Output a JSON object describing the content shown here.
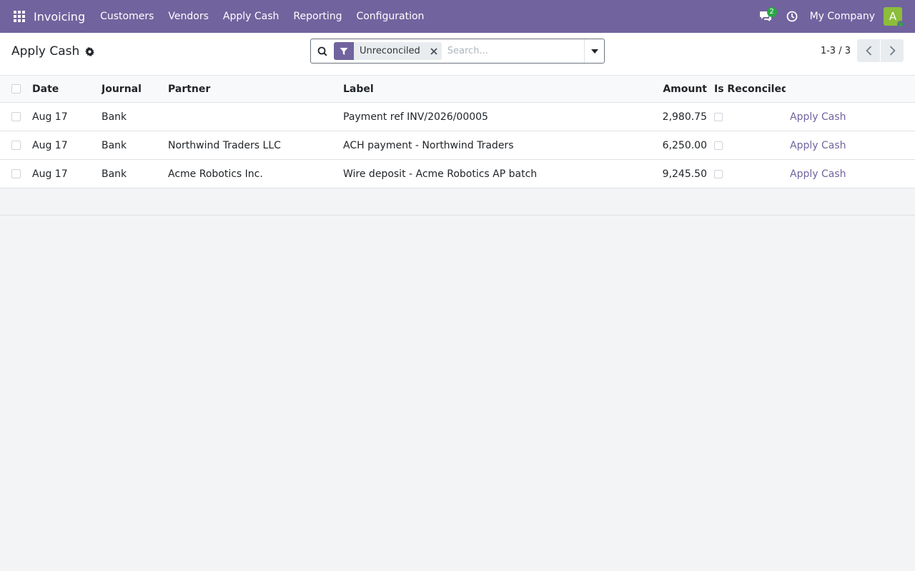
{
  "navbar": {
    "app_name": "Invoicing",
    "menu": [
      {
        "label": "Customers"
      },
      {
        "label": "Vendors"
      },
      {
        "label": "Apply Cash"
      },
      {
        "label": "Reporting"
      },
      {
        "label": "Configuration"
      }
    ],
    "chat_count": "2",
    "company": "My Company",
    "avatar_letter": "A"
  },
  "control": {
    "title": "Apply Cash",
    "search": {
      "facet": "Unreconciled",
      "placeholder": "Search..."
    },
    "pager": "1-3 / 3"
  },
  "table": {
    "columns": {
      "date": "Date",
      "journal": "Journal",
      "partner": "Partner",
      "label": "Label",
      "amount": "Amount",
      "is_reconciled": "Is Reconciled"
    },
    "rows": [
      {
        "date": "Aug 17",
        "journal": "Bank",
        "partner": "",
        "label": "Payment ref INV/2026/00005",
        "amount": "2,980.75",
        "is_reconciled": false,
        "action": "Apply Cash"
      },
      {
        "date": "Aug 17",
        "journal": "Bank",
        "partner": "Northwind Traders LLC",
        "label": "ACH payment - Northwind Traders",
        "amount": "6,250.00",
        "is_reconciled": false,
        "action": "Apply Cash"
      },
      {
        "date": "Aug 17",
        "journal": "Bank",
        "partner": "Acme Robotics Inc.",
        "label": "Wire deposit - Acme Robotics AP batch",
        "amount": "9,245.50",
        "is_reconciled": false,
        "action": "Apply Cash"
      }
    ]
  },
  "colors": {
    "brand": "#71639e",
    "avatar": "#8cbd3b",
    "badge": "#28a745"
  },
  "icons": [
    "apps-grid-icon",
    "chat-icon",
    "clock-icon",
    "gear-icon",
    "search-icon",
    "filter-icon",
    "close-icon",
    "caret-down-icon",
    "chevron-left-icon",
    "chevron-right-icon"
  ]
}
